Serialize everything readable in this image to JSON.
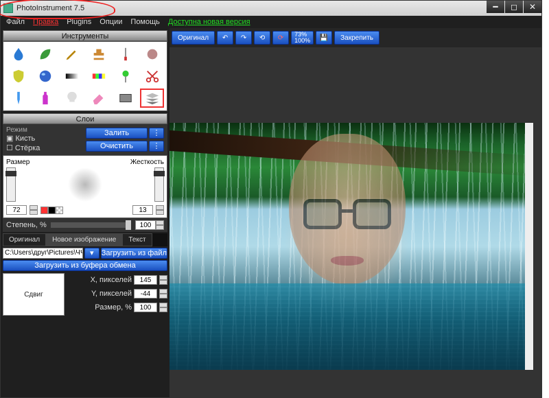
{
  "title": "PhotoInstrument 7.5",
  "menu": {
    "file": "Файл",
    "edit": "Правка",
    "plugins": "Plugins",
    "options": "Опции",
    "help": "Помощь",
    "update": "Доступна новая версия"
  },
  "panels": {
    "tools": "Инструменты",
    "layers": "Слои"
  },
  "mode": {
    "label": "Режим",
    "brush": "Кисть",
    "eraser": "Стёрка",
    "fill": "Залить",
    "clear": "Очистить"
  },
  "brush": {
    "size_label": "Размер",
    "hard_label": "Жесткость",
    "size": "72",
    "hard": "13"
  },
  "degree": {
    "label": "Степень, %",
    "value": "100"
  },
  "tabs": {
    "orig": "Оригинал",
    "newimg": "Новое изображение",
    "text": "Текст"
  },
  "file": {
    "path": "C:\\Users\\друг\\Pictures\\ЧЧЧ.P",
    "load": "Загрузить из файл",
    "clip": "Загрузить из буфера обмена"
  },
  "shift": {
    "label": "Сдвиг",
    "xlabel": "X, пикселей",
    "ylabel": "Y, пикселей",
    "sizelabel": "Размер, %",
    "x": "145",
    "y": "-44",
    "size": "100"
  },
  "toolbar": {
    "original": "Оригинал",
    "zoom": "73%\n100%",
    "pin": "Закрепить"
  }
}
